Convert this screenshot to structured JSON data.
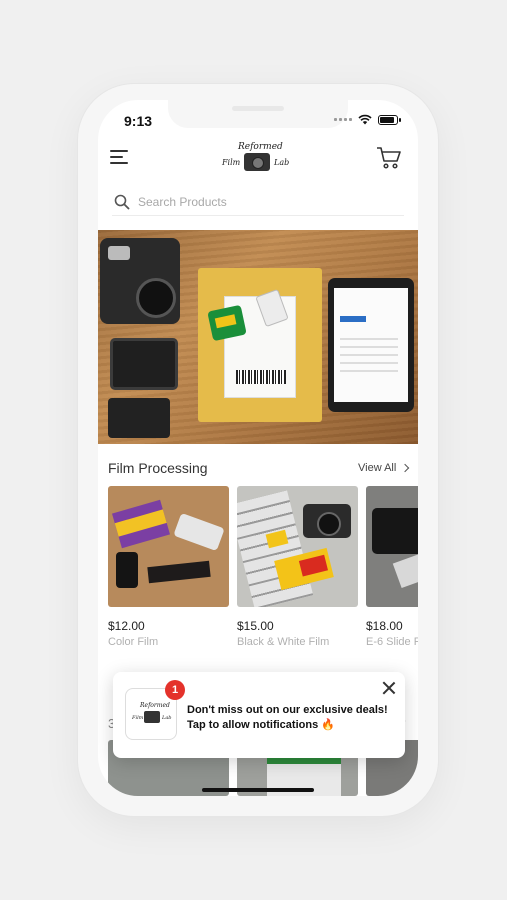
{
  "status_bar": {
    "time": "9:13"
  },
  "header": {
    "logo": {
      "line1": "Reformed",
      "left": "Film",
      "right": "Lab"
    }
  },
  "search": {
    "placeholder": "Search Products"
  },
  "section": {
    "title": "Film Processing",
    "view_all": "View All"
  },
  "products": [
    {
      "price": "$12.00",
      "name": "Color Film"
    },
    {
      "price": "$15.00",
      "name": "Black & White Film"
    },
    {
      "price": "$18.00",
      "name": "E-6 Slide F"
    }
  ],
  "notification": {
    "badge": "1",
    "line1": "Don't miss out on our exclusive deals!",
    "line2": "Tap to allow notifications 🔥",
    "logo": {
      "line1": "Reformed",
      "left": "Film",
      "right": "Lab"
    }
  },
  "behind_section": {
    "title_fragment": "3"
  },
  "icons": [
    "menu-icon",
    "cart-icon",
    "search-icon",
    "chevron-right-icon",
    "close-icon",
    "wifi-icon",
    "battery-icon"
  ],
  "colors": {
    "badge": "#e4322b",
    "background": "#f0f0f0"
  }
}
